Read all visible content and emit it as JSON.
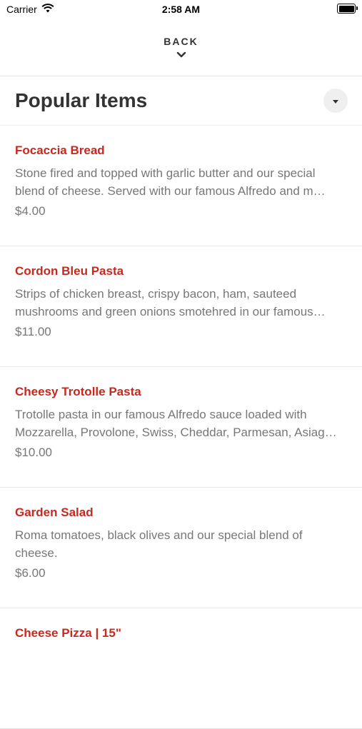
{
  "status_bar": {
    "carrier": "Carrier",
    "time": "2:58 AM"
  },
  "nav": {
    "back_label": "BACK"
  },
  "section": {
    "title": "Popular Items"
  },
  "colors": {
    "item_name": "#c8281e",
    "text_secondary": "#777777"
  },
  "items": [
    {
      "name": "Focaccia Bread",
      "description": "Stone fired and topped with garlic butter and our special blend of cheese. Served with our famous Alfredo and m…",
      "price": "$4.00"
    },
    {
      "name": "Cordon Bleu Pasta",
      "description": "Strips of chicken breast, crispy bacon, ham, sauteed mushrooms and green onions smotehred in our famous…",
      "price": "$11.00"
    },
    {
      "name": "Cheesy Trotolle Pasta",
      "description": "Trotolle pasta in our famous Alfredo sauce loaded with Mozzarella, Provolone, Swiss, Cheddar, Parmesan, Asiag…",
      "price": "$10.00"
    },
    {
      "name": "Garden Salad",
      "description": "Roma tomatoes, black olives and our special blend of cheese.",
      "price": "$6.00"
    },
    {
      "name": "Cheese Pizza | 15\"",
      "description": "",
      "price": ""
    }
  ]
}
